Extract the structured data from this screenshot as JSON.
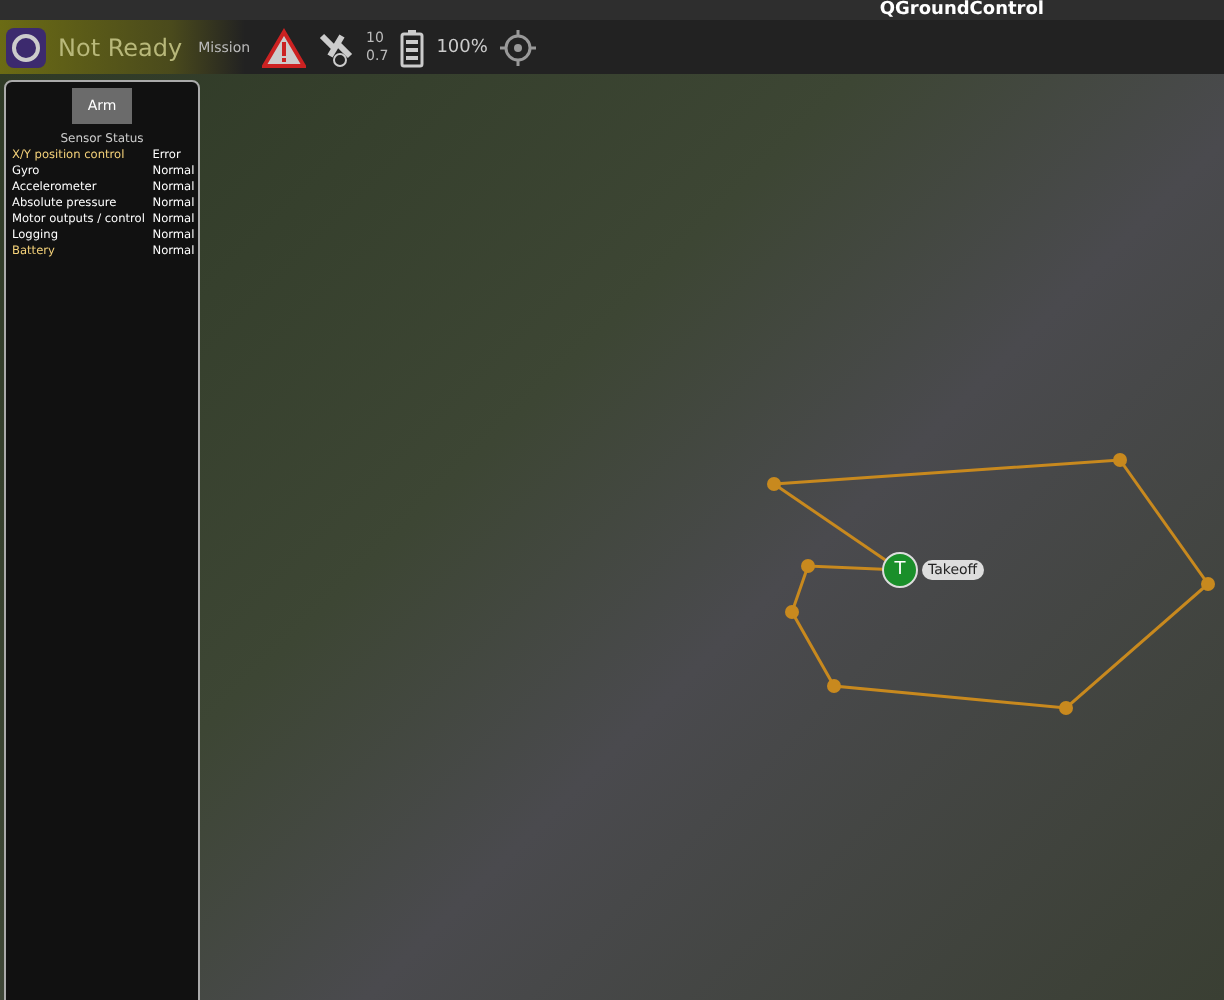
{
  "window": {
    "title": "QGroundControl"
  },
  "toolbar": {
    "status": "Not Ready",
    "mode": "Mission",
    "satellites": {
      "count": "10",
      "hdop": "0.7"
    },
    "battery": "100%"
  },
  "sensor_panel": {
    "arm_button": "Arm",
    "title": "Sensor Status",
    "sensors": [
      {
        "name": "X/Y position control",
        "status": "Error",
        "kind": "error"
      },
      {
        "name": "Gyro",
        "status": "Normal",
        "kind": "normal"
      },
      {
        "name": "Accelerometer",
        "status": "Normal",
        "kind": "normal"
      },
      {
        "name": "Absolute pressure",
        "status": "Normal",
        "kind": "normal"
      },
      {
        "name": "Motor outputs / control",
        "status": "Normal",
        "kind": "normal"
      },
      {
        "name": "Logging",
        "status": "Normal",
        "kind": "normal"
      },
      {
        "name": "Battery",
        "status": "Normal",
        "kind": "error"
      }
    ]
  },
  "map": {
    "takeoff": {
      "marker": "T",
      "label": "Takeoff"
    }
  }
}
